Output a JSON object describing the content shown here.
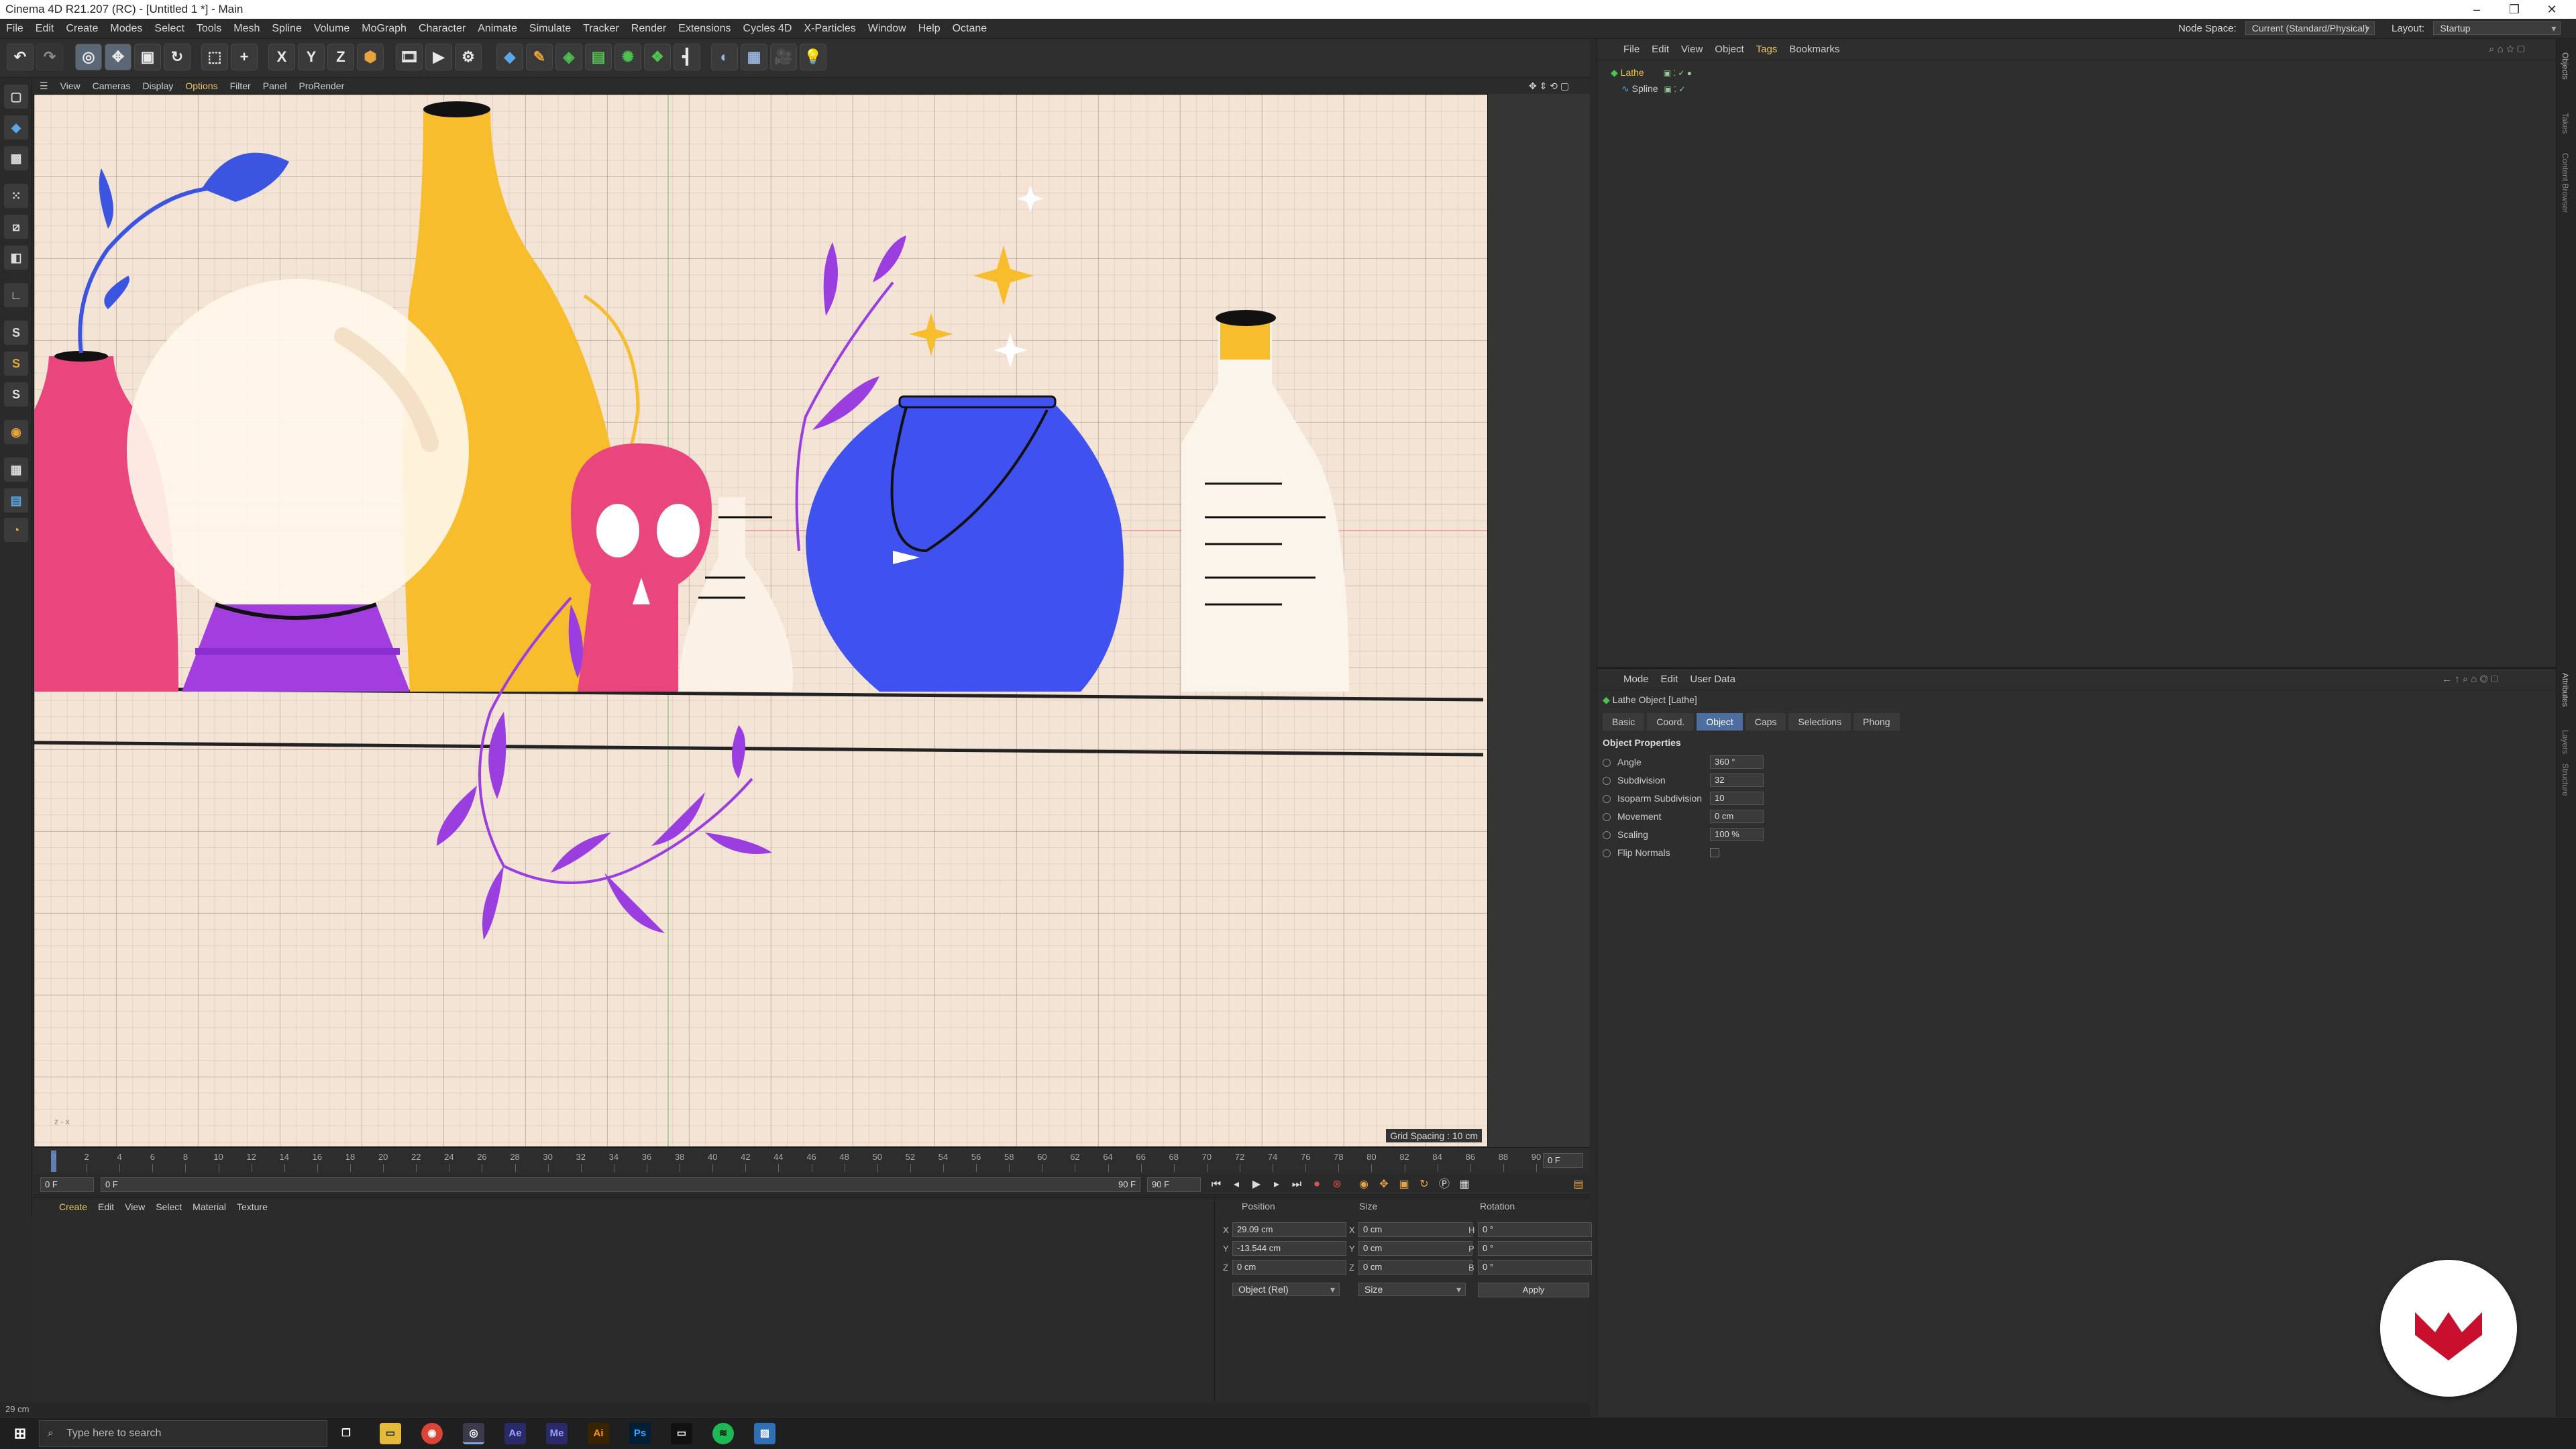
{
  "window": {
    "title": "Cinema 4D R21.207 (RC) - [Untitled 1 *] - Main"
  },
  "menu": {
    "items": [
      "File",
      "Edit",
      "Create",
      "Modes",
      "Select",
      "Tools",
      "Mesh",
      "Spline",
      "Volume",
      "MoGraph",
      "Character",
      "Animate",
      "Simulate",
      "Tracker",
      "Render",
      "Extensions",
      "Cycles 4D",
      "X-Particles",
      "Window",
      "Help",
      "Octane"
    ],
    "node_space_label": "Node Space:",
    "node_space_value": "Current (Standard/Physical)",
    "layout_label": "Layout:",
    "layout_value": "Startup"
  },
  "toolbar": {
    "x": "X",
    "y": "Y",
    "z": "Z"
  },
  "viewport": {
    "menu": [
      "View",
      "Cameras",
      "Display",
      "Options",
      "Filter",
      "Panel",
      "ProRender"
    ],
    "grid_spacing": "Grid Spacing : 10 cm",
    "axis_label": "z - x"
  },
  "timeline": {
    "ticks": [
      "0",
      "2",
      "4",
      "6",
      "8",
      "10",
      "12",
      "14",
      "16",
      "18",
      "20",
      "22",
      "24",
      "26",
      "28",
      "30",
      "32",
      "34",
      "36",
      "38",
      "40",
      "42",
      "44",
      "46",
      "48",
      "50",
      "52",
      "54",
      "56",
      "58",
      "60",
      "62",
      "64",
      "66",
      "68",
      "70",
      "72",
      "74",
      "76",
      "78",
      "80",
      "82",
      "84",
      "86",
      "88",
      "90"
    ],
    "current_frame_right": "0 F",
    "start": "0 F",
    "range_start": "0 F",
    "range_end": "90 F",
    "end": "90 F"
  },
  "material": {
    "menu": [
      "Create",
      "Edit",
      "View",
      "Select",
      "Material",
      "Texture"
    ]
  },
  "coords": {
    "headers": {
      "position": "Position",
      "size": "Size",
      "rotation": "Rotation"
    },
    "rows": [
      {
        "axis": "X",
        "pos": "29.09 cm",
        "saxis": "X",
        "size": "0 cm",
        "raxis": "H",
        "rot": "0 °"
      },
      {
        "axis": "Y",
        "pos": "-13.544 cm",
        "saxis": "Y",
        "size": "0 cm",
        "raxis": "P",
        "rot": "0 °"
      },
      {
        "axis": "Z",
        "pos": "0 cm",
        "saxis": "Z",
        "size": "0 cm",
        "raxis": "B",
        "rot": "0 °"
      }
    ],
    "mode": "Object (Rel)",
    "size_mode": "Size",
    "apply": "Apply"
  },
  "status": {
    "text": "29 cm"
  },
  "objects": {
    "menu": [
      "File",
      "Edit",
      "View",
      "Object",
      "Tags",
      "Bookmarks"
    ],
    "items": [
      {
        "name": "Lathe",
        "color": "#f0c040"
      },
      {
        "name": "Spline",
        "color": "#cfcfcf"
      }
    ]
  },
  "attributes": {
    "menu": [
      "Mode",
      "Edit",
      "User Data"
    ],
    "object_title": "Lathe Object [Lathe]",
    "tabs": [
      "Basic",
      "Coord.",
      "Object",
      "Caps",
      "Selections",
      "Phong"
    ],
    "active_tab": "Object",
    "section": "Object Properties",
    "props": [
      {
        "label": "Angle",
        "value": "360 °"
      },
      {
        "label": "Subdivision",
        "value": "32"
      },
      {
        "label": "Isoparm Subdivision",
        "value": "10"
      },
      {
        "label": "Movement",
        "value": "0 cm"
      },
      {
        "label": "Scaling",
        "value": "100 %"
      },
      {
        "label": "Flip Normals",
        "value": ""
      }
    ]
  },
  "side_tabs": [
    "Objects",
    "Takes",
    "Content Browser",
    "Attributes",
    "Layers",
    "Structure"
  ],
  "taskbar": {
    "search_placeholder": "Type here to search"
  }
}
